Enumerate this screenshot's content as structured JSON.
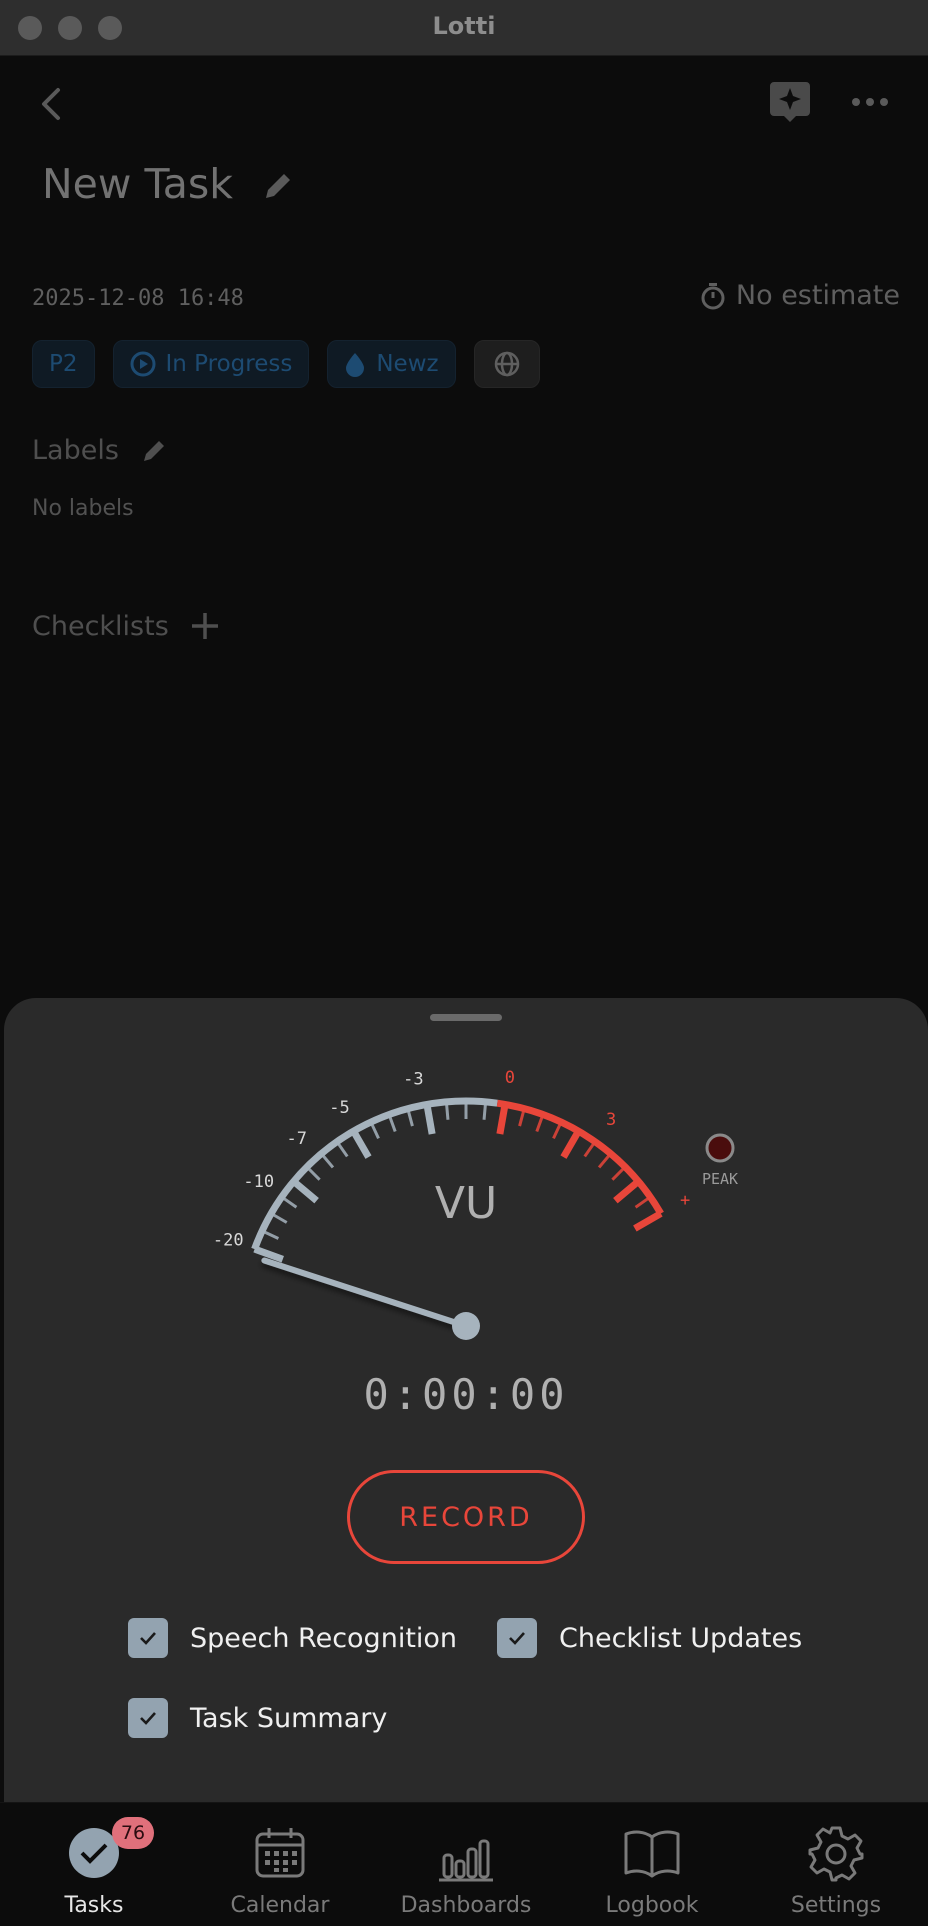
{
  "window": {
    "title": "Lotti"
  },
  "task": {
    "title": "New Task",
    "date": "2025-12-08 16:48",
    "estimate": "No estimate",
    "chips": {
      "priority": "P2",
      "status": "In Progress",
      "category": "Newz"
    },
    "labels_heading": "Labels",
    "no_labels": "No labels",
    "checklists_heading": "Checklists"
  },
  "recorder": {
    "meter_label": "VU",
    "scale_labels": [
      "-20",
      "-10",
      "-7",
      "-5",
      "-3",
      "0",
      "3",
      "+"
    ],
    "peak_label": "PEAK",
    "level_db": -20,
    "timer": "0:00:00",
    "record_label": "RECORD",
    "options": [
      {
        "label": "Speech Recognition",
        "checked": true
      },
      {
        "label": "Checklist Updates",
        "checked": true
      },
      {
        "label": "Task Summary",
        "checked": true
      }
    ],
    "colors": {
      "normal": "#a6b3bd",
      "red_zone": "#e8463a",
      "needle": "#a6b3bd"
    }
  },
  "nav": {
    "items": [
      {
        "label": "Tasks",
        "icon": "check-circle-icon",
        "active": true,
        "badge": "76"
      },
      {
        "label": "Calendar",
        "icon": "calendar-icon",
        "active": false
      },
      {
        "label": "Dashboards",
        "icon": "bar-chart-icon",
        "active": false
      },
      {
        "label": "Logbook",
        "icon": "book-icon",
        "active": false
      },
      {
        "label": "Settings",
        "icon": "gear-icon",
        "active": false
      }
    ]
  }
}
